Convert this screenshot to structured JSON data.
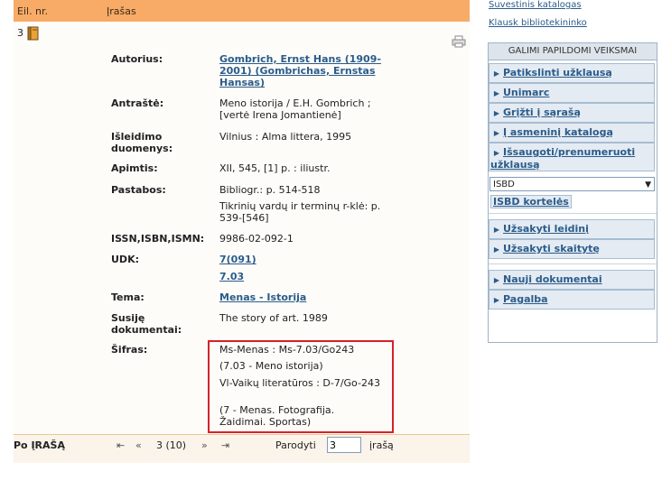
{
  "header": {
    "col_nr": "Eil. nr.",
    "col_record": "Įrašas"
  },
  "record": {
    "number": "3",
    "fields": [
      {
        "label": "Autorius:",
        "value": "Gombrich, Ernst Hans (1909-2001) (Gombrichas, Ernstas Hansas)"
      },
      {
        "label": "Antraštė:",
        "value": "Meno istorija / E.H. Gombrich ; [vertė Irena Jomantienė]"
      },
      {
        "label": "Išleidimo duomenys:",
        "value": "Vilnius : Alma littera, 1995"
      },
      {
        "label": "Apimtis:",
        "value": "XII, 545, [1] p. : iliustr."
      },
      {
        "label": "Pastabos:",
        "value": "Bibliogr.: p. 514-518",
        "value2": "Tikrinių vardų ir terminų r-klė: p. 539-[546]"
      },
      {
        "label": "ISSN,ISBN,ISMN:",
        "value": "9986-02-092-1"
      },
      {
        "label": "UDK:",
        "value": "7(091)",
        "value2": "7.03"
      },
      {
        "label": "Tema:",
        "value": "Menas - Istorija"
      },
      {
        "label": "Susiję dokumentai:",
        "value": "The story of art. 1989"
      },
      {
        "label": "Šifras:",
        "lines": [
          "Ms-Menas : Ms-7.03/Go243",
          "(7.03 - Meno istorija)",
          "Vl-Vaikų literatūros : D-7/Go-243",
          "(7 - Menas. Fotografija. Žaidimai. Sportas)"
        ]
      }
    ]
  },
  "footer": {
    "po_irasa": "Po ĮRAŠĄ",
    "nav_first": "⇤",
    "nav_prev": "«",
    "position": "3 (10)",
    "nav_next": "»",
    "nav_last": "⇥",
    "show_label": "Parodyti",
    "show_value": "3",
    "show_unit": "įrašą"
  },
  "sidebar": {
    "top_link_1": "Suvestinis katalogas",
    "top_link_2": "Klausk bibliotekininko",
    "panel_title": "GALIMI PAPILDOMI VEIKSMAI",
    "actions_1": [
      "Patikslinti užklausą",
      "Unimarc",
      "Grįžti į sąrašą",
      "Į asmeninį katalogą",
      "Išsaugoti/prenumeruoti užklausą"
    ],
    "select_value": "ISBD",
    "isbd_button": "ISBD kortelės",
    "actions_2": [
      "Užsakyti leidinį",
      "Užsakyti skaitytę"
    ],
    "actions_3": [
      "Nauji dokumentai",
      "Pagalba"
    ]
  },
  "icons": {
    "book": "book-icon",
    "print": "print-icon",
    "arrow": "triangle-right-icon"
  },
  "colors": {
    "header_bg": "#f7ab66",
    "accent_link": "#2b5c8a",
    "highlight_border": "#d42327",
    "button_bg": "#e4ebf3"
  }
}
